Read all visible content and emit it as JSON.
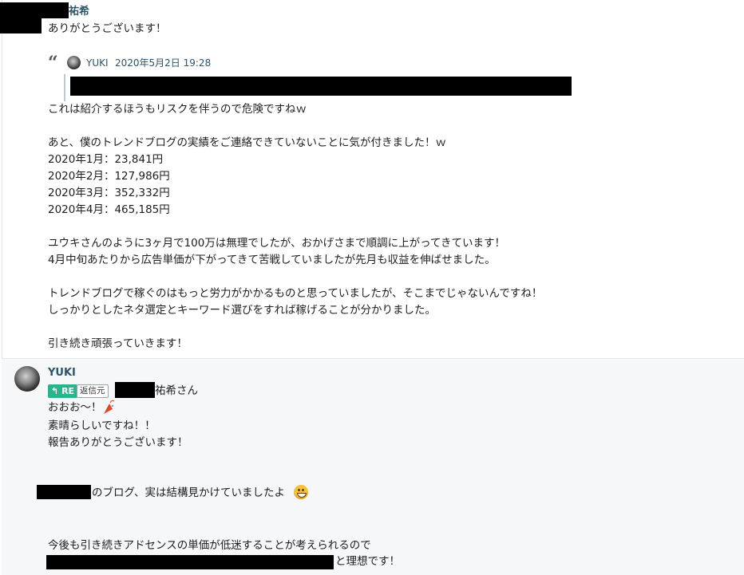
{
  "message1": {
    "sender_suffix": "祐希",
    "thanks": "ありがとうございます！",
    "quote": {
      "author": "YUKI",
      "datetime": "2020年5月2日 19:28"
    },
    "lines": [
      "これは紹介するほうもリスクを伴うので危険ですねｗ",
      "あと、僕のトレンドブログの実績をご連絡できていないことに気が付きました！ｗ",
      "2020年1月：23,841円",
      "2020年2月：127,986円",
      "2020年3月：352,332円",
      "2020年4月：465,185円",
      "ユウキさんのように3ヶ月で100万は無理でしたが、おかげさまで順調に上がってきています！",
      "4月中旬あたりから広告単価が下がってきて苦戦していましたが先月も収益を伸ばせました。",
      "トレンドブログで稼ぐのはもっと労力がかかるものと思っていましたが、そこまでじゃないんですね！",
      "しっかりとしたネタ選定とキーワード選びをすれば稼げることが分かりました。",
      "引き続き頑張っていきます！"
    ]
  },
  "message2": {
    "sender": "YUKI",
    "re_label": "RE",
    "reply_source_label": "返信元",
    "addressee_suffix": "祐希さん",
    "lines": [
      "おおお〜！",
      "素晴らしいですね！！",
      "報告ありがとうございます！",
      "のブログ、実は結構見かけていましたよ",
      "今後も引き続きアドセンスの単価が低迷することが考えられるので",
      "と理想です！"
    ]
  },
  "icons": [
    "quote-icon",
    "avatar",
    "reply-arrow-icon",
    "party-popper-icon",
    "smile-emoji-icon"
  ],
  "colors": {
    "name": "#2b546b",
    "re_badge": "#2bb38c",
    "reply_bg": "#f5f7f9"
  }
}
